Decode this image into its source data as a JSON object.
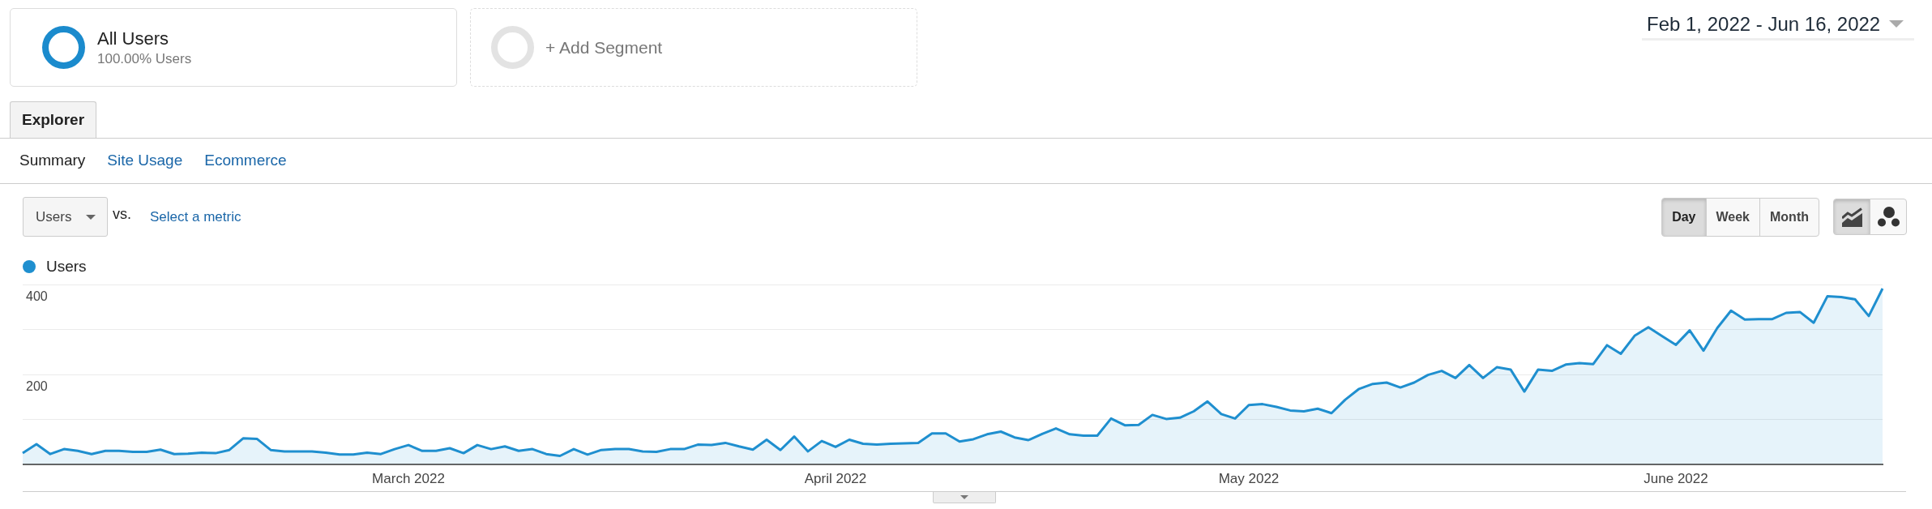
{
  "segments": [
    {
      "kind": "segment",
      "title": "All Users",
      "subtitle": "100.00% Users"
    },
    {
      "kind": "add",
      "label": "+ Add Segment"
    }
  ],
  "date_range": {
    "label": "Feb 1, 2022 - Jun 16, 2022"
  },
  "tabs": [
    {
      "label": "Explorer",
      "selected": true
    }
  ],
  "subtabs": [
    {
      "label": "Summary",
      "selected": true
    },
    {
      "label": "Site Usage",
      "selected": false
    },
    {
      "label": "Ecommerce",
      "selected": false
    }
  ],
  "metric_bar": {
    "metric": "Users",
    "vs": "vs.",
    "secondary_link": "Select a metric"
  },
  "interval_buttons": [
    {
      "label": "Day",
      "selected": true
    },
    {
      "label": "Week",
      "selected": false
    },
    {
      "label": "Month",
      "selected": false
    }
  ],
  "chart_type_buttons": [
    {
      "kind": "line",
      "selected": true
    },
    {
      "kind": "motion",
      "selected": false
    }
  ],
  "chart": {
    "chart_data": {
      "type": "area",
      "categories": [
        null,
        null,
        null,
        null,
        null,
        null,
        null,
        null,
        null,
        null,
        null,
        null,
        null,
        null,
        null,
        null,
        null,
        null,
        null,
        null,
        null,
        null,
        null,
        null,
        null,
        null,
        null,
        null,
        "March 2022",
        null,
        null,
        null,
        null,
        null,
        null,
        null,
        null,
        null,
        null,
        null,
        null,
        null,
        null,
        null,
        null,
        null,
        null,
        null,
        null,
        null,
        null,
        null,
        null,
        null,
        null,
        null,
        null,
        null,
        null,
        "April 2022",
        null,
        null,
        null,
        null,
        null,
        null,
        null,
        null,
        null,
        null,
        null,
        null,
        null,
        null,
        null,
        null,
        null,
        null,
        null,
        null,
        null,
        null,
        null,
        null,
        null,
        null,
        null,
        null,
        null,
        "May 2022",
        null,
        null,
        null,
        null,
        null,
        null,
        null,
        null,
        null,
        null,
        null,
        null,
        null,
        null,
        null,
        null,
        null,
        null,
        null,
        null,
        null,
        null,
        null,
        null,
        null,
        null,
        null,
        null,
        null,
        null,
        "June 2022",
        null,
        null,
        null,
        null,
        null,
        null,
        null,
        null,
        null,
        null,
        null,
        null,
        null,
        null,
        null
      ],
      "series": [
        {
          "name": "Users",
          "color": "#1f8fcf",
          "values": [
            25,
            45,
            23,
            34,
            30,
            23,
            30,
            30,
            28,
            28,
            33,
            23,
            24,
            26,
            25,
            32,
            58,
            57,
            32,
            29,
            29,
            29,
            26,
            22,
            22,
            26,
            23,
            34,
            43,
            30,
            30,
            36,
            25,
            43,
            34,
            40,
            30,
            34,
            23,
            19,
            34,
            22,
            32,
            34,
            34,
            29,
            28,
            34,
            34,
            44,
            43,
            48,
            40,
            33,
            55,
            32,
            62,
            29,
            52,
            39,
            55,
            46,
            44,
            46,
            47,
            48,
            69,
            69,
            51,
            56,
            67,
            73,
            60,
            54,
            68,
            80,
            67,
            64,
            64,
            102,
            87,
            88,
            110,
            101,
            104,
            118,
            140,
            112,
            102,
            132,
            134,
            128,
            120,
            118,
            124,
            114,
            144,
            168,
            179,
            182,
            171,
            182,
            199,
            208,
            192,
            221,
            192,
            216,
            211,
            162,
            211,
            208,
            222,
            225,
            223,
            265,
            246,
            286,
            305,
            285,
            266,
            298,
            253,
            303,
            342,
            322,
            323,
            323,
            337,
            339,
            315,
            374,
            372,
            367,
            330,
            391
          ]
        }
      ],
      "ylim": [
        0,
        400
      ],
      "yticks": [
        {
          "value": 100,
          "label": null
        },
        200,
        {
          "value": 300,
          "label": null
        },
        400
      ],
      "grid": true
    }
  }
}
